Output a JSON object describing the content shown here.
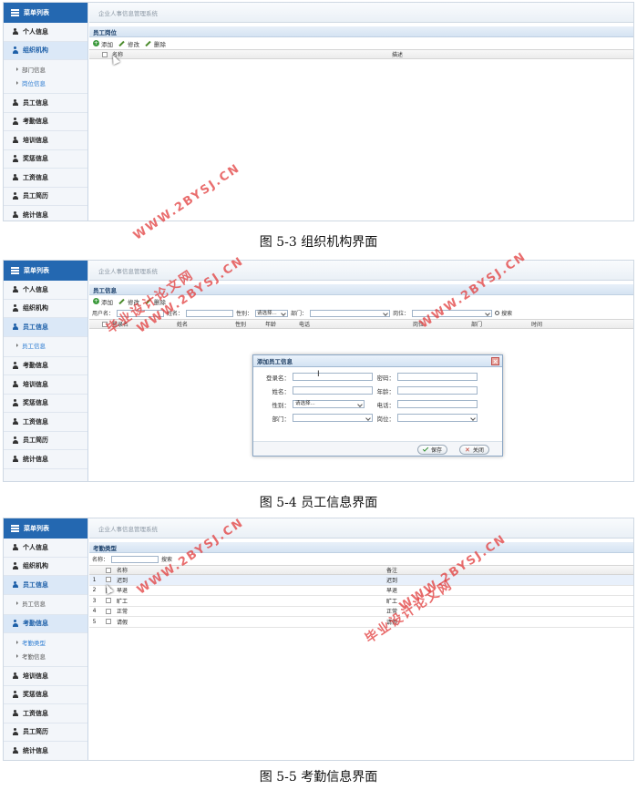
{
  "captions": {
    "fig3": "图 5-3 组织机构界面",
    "fig4": "图 5-4 员工信息界面",
    "fig5": "图 5-5 考勤信息界面"
  },
  "watermark": {
    "text1": "毕业设计论文网",
    "text2": "WWW.2BYSJ.CN",
    "color": "#e03c3c"
  },
  "app": {
    "menu_title": "菜单列表",
    "system_title": "企业人事信息管理系统"
  },
  "shot1": {
    "menu": [
      "个人信息",
      "组织机构",
      "员工信息",
      "考勤信息",
      "培训信息",
      "奖惩信息",
      "工资信息",
      "员工简历",
      "统计信息"
    ],
    "submenu": [
      "部门信息",
      "岗位信息"
    ],
    "panel_title": "员工岗位",
    "toolbar": {
      "add": "添加",
      "edit": "修改",
      "delete": "删除"
    },
    "columns": {
      "name": "名称",
      "desc": "描述"
    }
  },
  "shot2": {
    "menu": [
      "个人信息",
      "组织机构",
      "员工信息",
      "考勤信息",
      "培训信息",
      "奖惩信息",
      "工资信息",
      "员工简历",
      "统计信息"
    ],
    "submenu": [
      "员工信息"
    ],
    "panel_title": "员工信息",
    "toolbar": {
      "add": "添加",
      "edit": "修改",
      "delete": "删除"
    },
    "search": {
      "username": "用户名：",
      "realname": "姓名：",
      "gender": "性别：",
      "gender_value": "请选择...",
      "dept": "部门：",
      "post": "岗位：",
      "button": "搜索"
    },
    "columns": [
      "登录名",
      "姓名",
      "性别",
      "年龄",
      "电话",
      "岗位",
      "部门",
      "时间"
    ],
    "dialog": {
      "title": "添加员工信息",
      "login": "登录名：",
      "password": "密码：",
      "name": "姓名：",
      "age": "年龄：",
      "gender": "性别：",
      "gender_value": "请选择...",
      "phone": "电话：",
      "dept": "部门：",
      "post": "岗位：",
      "save": "保存",
      "close": "关闭"
    }
  },
  "shot3": {
    "menu_top": [
      "个人信息",
      "组织机构",
      "员工信息"
    ],
    "submenu1": [
      "员工信息"
    ],
    "menu_mid": [
      "考勤信息"
    ],
    "submenu2": [
      "考勤类型",
      "考勤信息"
    ],
    "menu_bottom": [
      "培训信息",
      "奖惩信息",
      "工资信息",
      "员工简历",
      "统计信息"
    ],
    "panel_title": "考勤类型",
    "search_label": "名称：",
    "search_button": "搜索",
    "columns": {
      "name": "名称",
      "note": "备注"
    },
    "rows": [
      {
        "num": "1",
        "name": "迟到",
        "note": "迟到"
      },
      {
        "num": "2",
        "name": "早退",
        "note": "早退"
      },
      {
        "num": "3",
        "name": "旷工",
        "note": "旷工"
      },
      {
        "num": "4",
        "name": "正常",
        "note": "正常"
      },
      {
        "num": "5",
        "name": "请假",
        "note": "请假"
      }
    ]
  }
}
